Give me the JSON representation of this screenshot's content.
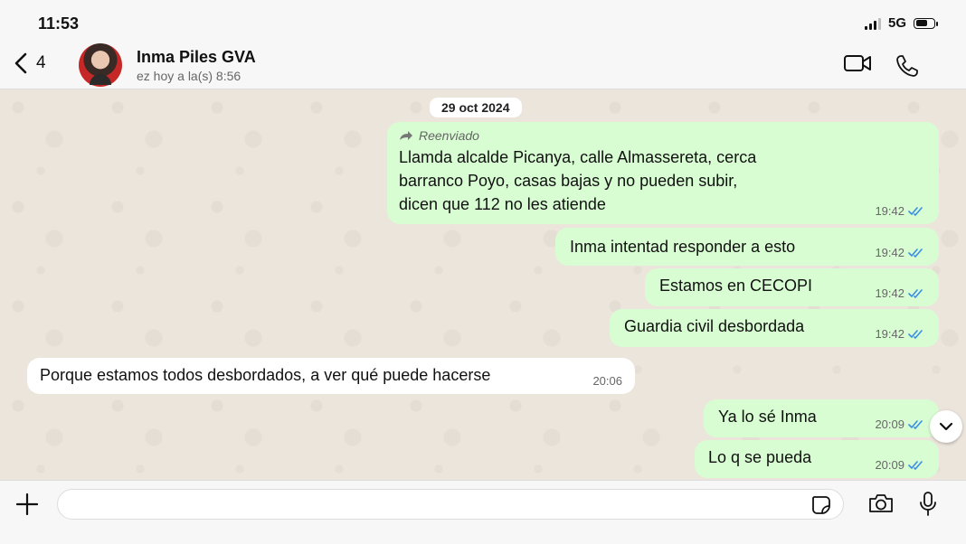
{
  "status_bar": {
    "time": "11:53",
    "network": "5G"
  },
  "header": {
    "back_count": "4",
    "contact_name": "Inma Piles GVA",
    "last_seen": "ez hoy a la(s) 8:56"
  },
  "chat": {
    "date": "29 oct 2024",
    "messages": [
      {
        "direction": "out",
        "forwarded_label": "Reenviado",
        "lines": [
          "Llamda alcalde Picanya, calle Almassereta, cerca",
          "barranco Poyo, casas bajas y no pueden subir,",
          "dicen que 112 no les atiende"
        ],
        "time": "19:42",
        "status": "read"
      },
      {
        "direction": "out",
        "text": "Inma intentad responder a esto",
        "time": "19:42",
        "status": "read"
      },
      {
        "direction": "out",
        "text": "Estamos en CECOPI",
        "time": "19:42",
        "status": "read"
      },
      {
        "direction": "out",
        "text": "Guardia civil desbordada",
        "time": "19:42",
        "status": "read"
      },
      {
        "direction": "in",
        "text": "Porque estamos todos desbordados, a ver qué puede hacerse",
        "time": "20:06"
      },
      {
        "direction": "out",
        "text": "Ya lo sé Inma",
        "time": "20:09",
        "status": "read"
      },
      {
        "direction": "out",
        "text": "Lo q se pueda",
        "time": "20:09",
        "status": "read"
      }
    ]
  },
  "input": {
    "value": "",
    "placeholder": ""
  },
  "colors": {
    "outgoing_bubble": "#d8fdd2",
    "incoming_bubble": "#ffffff",
    "read_ticks": "#3a8ee6",
    "chat_background": "#ece5dc"
  },
  "icons": [
    "chevron-left-icon",
    "video-call-icon",
    "phone-icon",
    "forward-arrow-icon",
    "double-check-icon",
    "chevron-down-icon",
    "plus-icon",
    "sticker-icon",
    "camera-icon",
    "microphone-icon"
  ]
}
